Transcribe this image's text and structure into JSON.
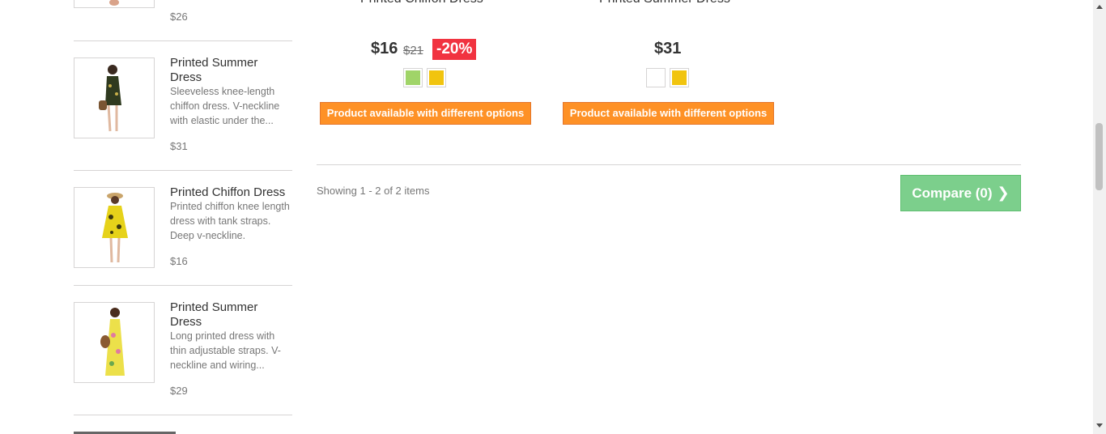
{
  "sidebar": {
    "items": [
      {
        "title": "",
        "description": "",
        "price": "$26"
      },
      {
        "title": "Printed Summer Dress",
        "description": "Sleeveless knee-length chiffon dress. V-neckline with elastic under the...",
        "price": "$31"
      },
      {
        "title": "Printed Chiffon Dress",
        "description": "Printed chiffon knee length dress with tank straps. Deep v-neckline.",
        "price": "$16"
      },
      {
        "title": "Printed Summer Dress",
        "description": "Long printed dress with thin adjustable straps. V-neckline and wiring...",
        "price": "$29"
      }
    ]
  },
  "products": [
    {
      "name": "Printed Chiffon Dress",
      "price": "$16",
      "old_price": "$21",
      "discount": "-20%",
      "swatches": [
        "#a0d468",
        "#f1c40f"
      ],
      "availability": "Product available with different options"
    },
    {
      "name": "Printed Summer Dress",
      "price": "$31",
      "swatches": [
        "#ffffff",
        "#f1c40f"
      ],
      "availability": "Product available with different options"
    }
  ],
  "pagination": {
    "showing": "Showing 1 - 2 of 2 items"
  },
  "compare": {
    "label": "Compare (0)",
    "icon": "chevron-right-icon"
  }
}
